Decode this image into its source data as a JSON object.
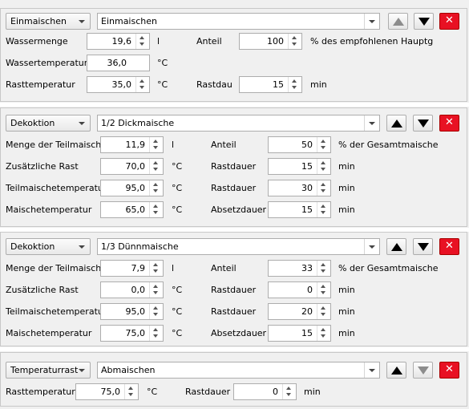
{
  "steps": [
    {
      "type": "Einmaischen",
      "name": "Einmaischen",
      "f1_label": "Wassermenge",
      "f1_value": "19,6",
      "f1_unit": "l",
      "f2_label": "Anteil",
      "f2_value": "100",
      "f2_unit": "% des empfohlenen Hauptgusses",
      "f3_label": "Wassertemperatur",
      "f3_value": "36,0",
      "f3_unit": "°C",
      "f5_label": "Rasttemperatur",
      "f5_value": "35,0",
      "f5_unit": "°C",
      "f6_label": "Rastdauer",
      "f6_value": "15",
      "f6_unit": "min"
    },
    {
      "type": "Dekoktion",
      "name": "1/2 Dickmaische",
      "f1_label": "Menge der Teilmaische",
      "f1_value": "11,9",
      "f1_unit": "l",
      "f2_label": "Anteil",
      "f2_value": "50",
      "f2_unit": "% der Gesamtmaische",
      "f3_label": "Zusätzliche Rast",
      "f3_value": "70,0",
      "f3_unit": "°C",
      "f4_label": "Rastdauer",
      "f4_value": "15",
      "f4_unit": "min",
      "f5_label": "Teilmaischetemperatur",
      "f5_value": "95,0",
      "f5_unit": "°C",
      "f6_label": "Rastdauer",
      "f6_value": "30",
      "f6_unit": "min",
      "f7_label": "Maischetemperatur",
      "f7_value": "65,0",
      "f7_unit": "°C",
      "f8_label": "Absetzdauer",
      "f8_value": "15",
      "f8_unit": "min"
    },
    {
      "type": "Dekoktion",
      "name": "1/3 Dünnmaische",
      "f1_label": "Menge der Teilmaische",
      "f1_value": "7,9",
      "f1_unit": "l",
      "f2_label": "Anteil",
      "f2_value": "33",
      "f2_unit": "% der Gesamtmaische",
      "f3_label": "Zusätzliche Rast",
      "f3_value": "0,0",
      "f3_unit": "°C",
      "f4_label": "Rastdauer",
      "f4_value": "0",
      "f4_unit": "min",
      "f5_label": "Teilmaischetemperatur",
      "f5_value": "95,0",
      "f5_unit": "°C",
      "f6_label": "Rastdauer",
      "f6_value": "20",
      "f6_unit": "min",
      "f7_label": "Maischetemperatur",
      "f7_value": "75,0",
      "f7_unit": "°C",
      "f8_label": "Absetzdauer",
      "f8_value": "15",
      "f8_unit": "min"
    },
    {
      "type": "Temperaturrast",
      "name": "Abmaischen",
      "f1_label": "Rasttemperatur",
      "f1_value": "75,0",
      "f1_unit": "°C",
      "f2_label": "Rastdauer",
      "f2_value": "0",
      "f2_unit": "min"
    }
  ],
  "icons": {
    "up": "arrow-up-icon",
    "down": "arrow-down-icon",
    "delete": "close-x-icon"
  },
  "colors": {
    "delete_button": "#e81123",
    "panel_bg": "#f0f0f0",
    "separator": "#ffffff"
  }
}
